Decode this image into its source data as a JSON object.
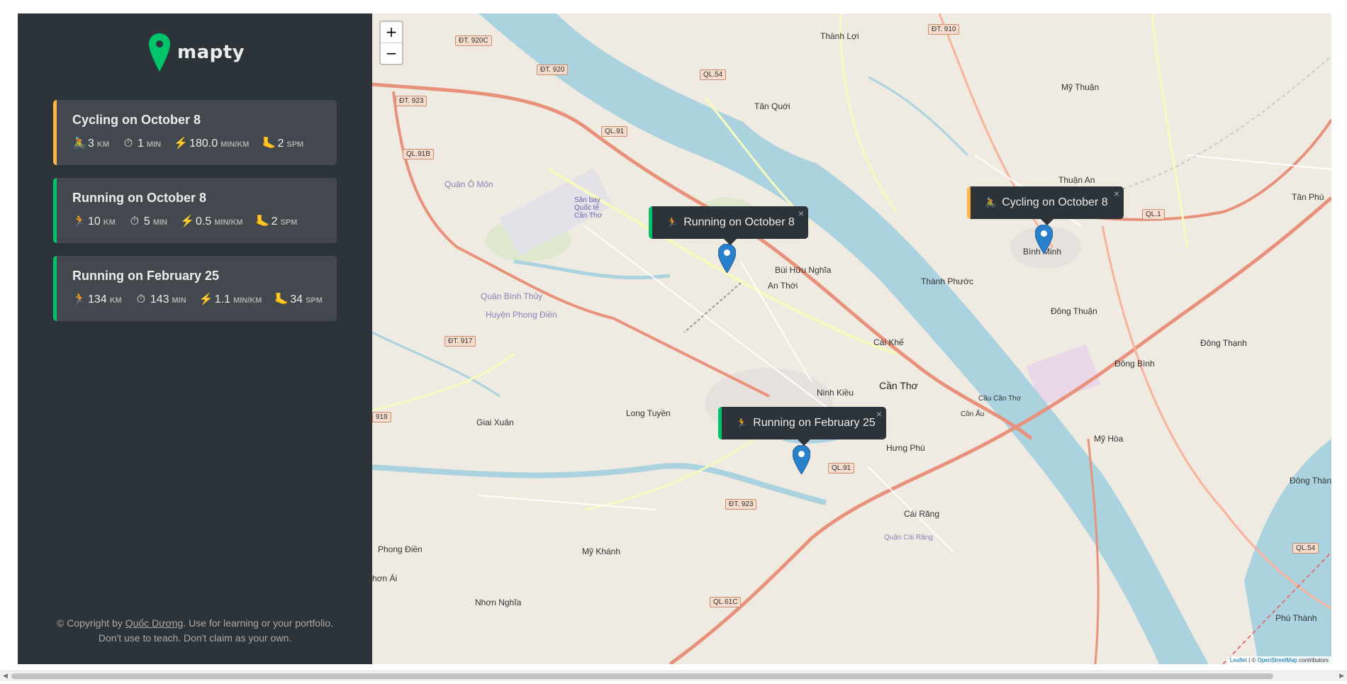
{
  "brand": {
    "name": "mapty",
    "accent": "#00c46a"
  },
  "workouts": [
    {
      "type": "cycling",
      "title": "Cycling on October 8",
      "stats": [
        {
          "icon": "🚴",
          "value": "3",
          "unit": "km"
        },
        {
          "icon": "⏱",
          "value": "1",
          "unit": "min"
        },
        {
          "icon": "⚡",
          "value": "180.0",
          "unit": "min/km"
        },
        {
          "icon": "🦶",
          "value": "2",
          "unit": "spm"
        }
      ]
    },
    {
      "type": "running",
      "title": "Running on October 8",
      "stats": [
        {
          "icon": "🏃",
          "value": "10",
          "unit": "km"
        },
        {
          "icon": "⏱",
          "value": "5",
          "unit": "min"
        },
        {
          "icon": "⚡",
          "value": "0.5",
          "unit": "min/km"
        },
        {
          "icon": "🦶",
          "value": "2",
          "unit": "spm"
        }
      ]
    },
    {
      "type": "running",
      "title": "Running on February 25",
      "stats": [
        {
          "icon": "🏃",
          "value": "134",
          "unit": "km"
        },
        {
          "icon": "⏱",
          "value": "143",
          "unit": "min"
        },
        {
          "icon": "⚡",
          "value": "1.1",
          "unit": "min/km"
        },
        {
          "icon": "🦶",
          "value": "34",
          "unit": "spm"
        }
      ]
    }
  ],
  "copyright": {
    "prefix": "© Copyright by",
    "author": "Quốc Dương",
    "suffix": ". Use for learning or your portfolio.",
    "line2": "Don't use to teach. Don't claim as your own."
  },
  "map": {
    "zoom_in": "+",
    "zoom_out": "−",
    "popups": [
      {
        "type": "running",
        "icon": "🏃",
        "text": "Running on October 8",
        "close": "×"
      },
      {
        "type": "cycling",
        "icon": "🚴",
        "text": "Cycling on October 8",
        "close": "×"
      },
      {
        "type": "running",
        "icon": "🏃",
        "text": "Running on February 25",
        "close": "×"
      }
    ],
    "place_labels": {
      "can_tho": "Cần Thơ",
      "binh_minh": "Bình Minh",
      "tan_quoi": "Tân Quới",
      "thanh_loi": "Thành Lợi",
      "my_thuan": "Mỹ Thuận",
      "thuan_an": "Thuận An",
      "tan_phu": "Tân Phú",
      "dong_thuan": "Đông Thuận",
      "dong_thanh": "Đông Thạnh",
      "dong_binh": "Đông Bình",
      "my_hoa": "Mỹ Hòa",
      "dong_than": "Đông Thàn",
      "phu_thanh": "Phú Thành",
      "thanh_phuoc": "Thành Phước",
      "bui_huu_nghia": "Bùi Hữu Nghĩa",
      "an_thoi": "An Thới",
      "cai_khe": "Cái Khế",
      "ninh_kieu": "Ninh Kiều",
      "hung_phu": "Hưng Phú",
      "cai_rang": "Cái Răng",
      "long_tuyen": "Long Tuyền",
      "giai_xuan": "Giai Xuân",
      "phong_dien": "Phong Điền",
      "my_khanh": "Mỹ Khánh",
      "nhon_nghia": "Nhơn Nghĩa",
      "nhon_ai": "hơn Ái",
      "son_bay": "Sân bay Quốc tế Cần Thơ",
      "quan_o_mon": "Quận Ô Môn",
      "quan_binh_thuy": "Quận Bình Thủy",
      "huyen_phong_dien": "Huyện Phong Điền",
      "cau_can_tho": "Cầu Cần Thơ",
      "con_au": "Cồn Ấu",
      "quan_cai_rang": "Quận Cái Răng"
    },
    "road_shields": [
      "ĐT. 920C",
      "ĐT. 920",
      "ĐT. 923",
      "QL.91B",
      "QL.54",
      "QL.91",
      "ĐT. 910",
      "ĐT. 917",
      "QL.1",
      "QL.91",
      "ĐT. 923",
      "QL.61C",
      "QL.54",
      "918"
    ],
    "attribution": {
      "leaflet": "Leaflet",
      "sep": " | © ",
      "osm": "OpenStreetMap",
      "suffix": " contributors"
    }
  }
}
